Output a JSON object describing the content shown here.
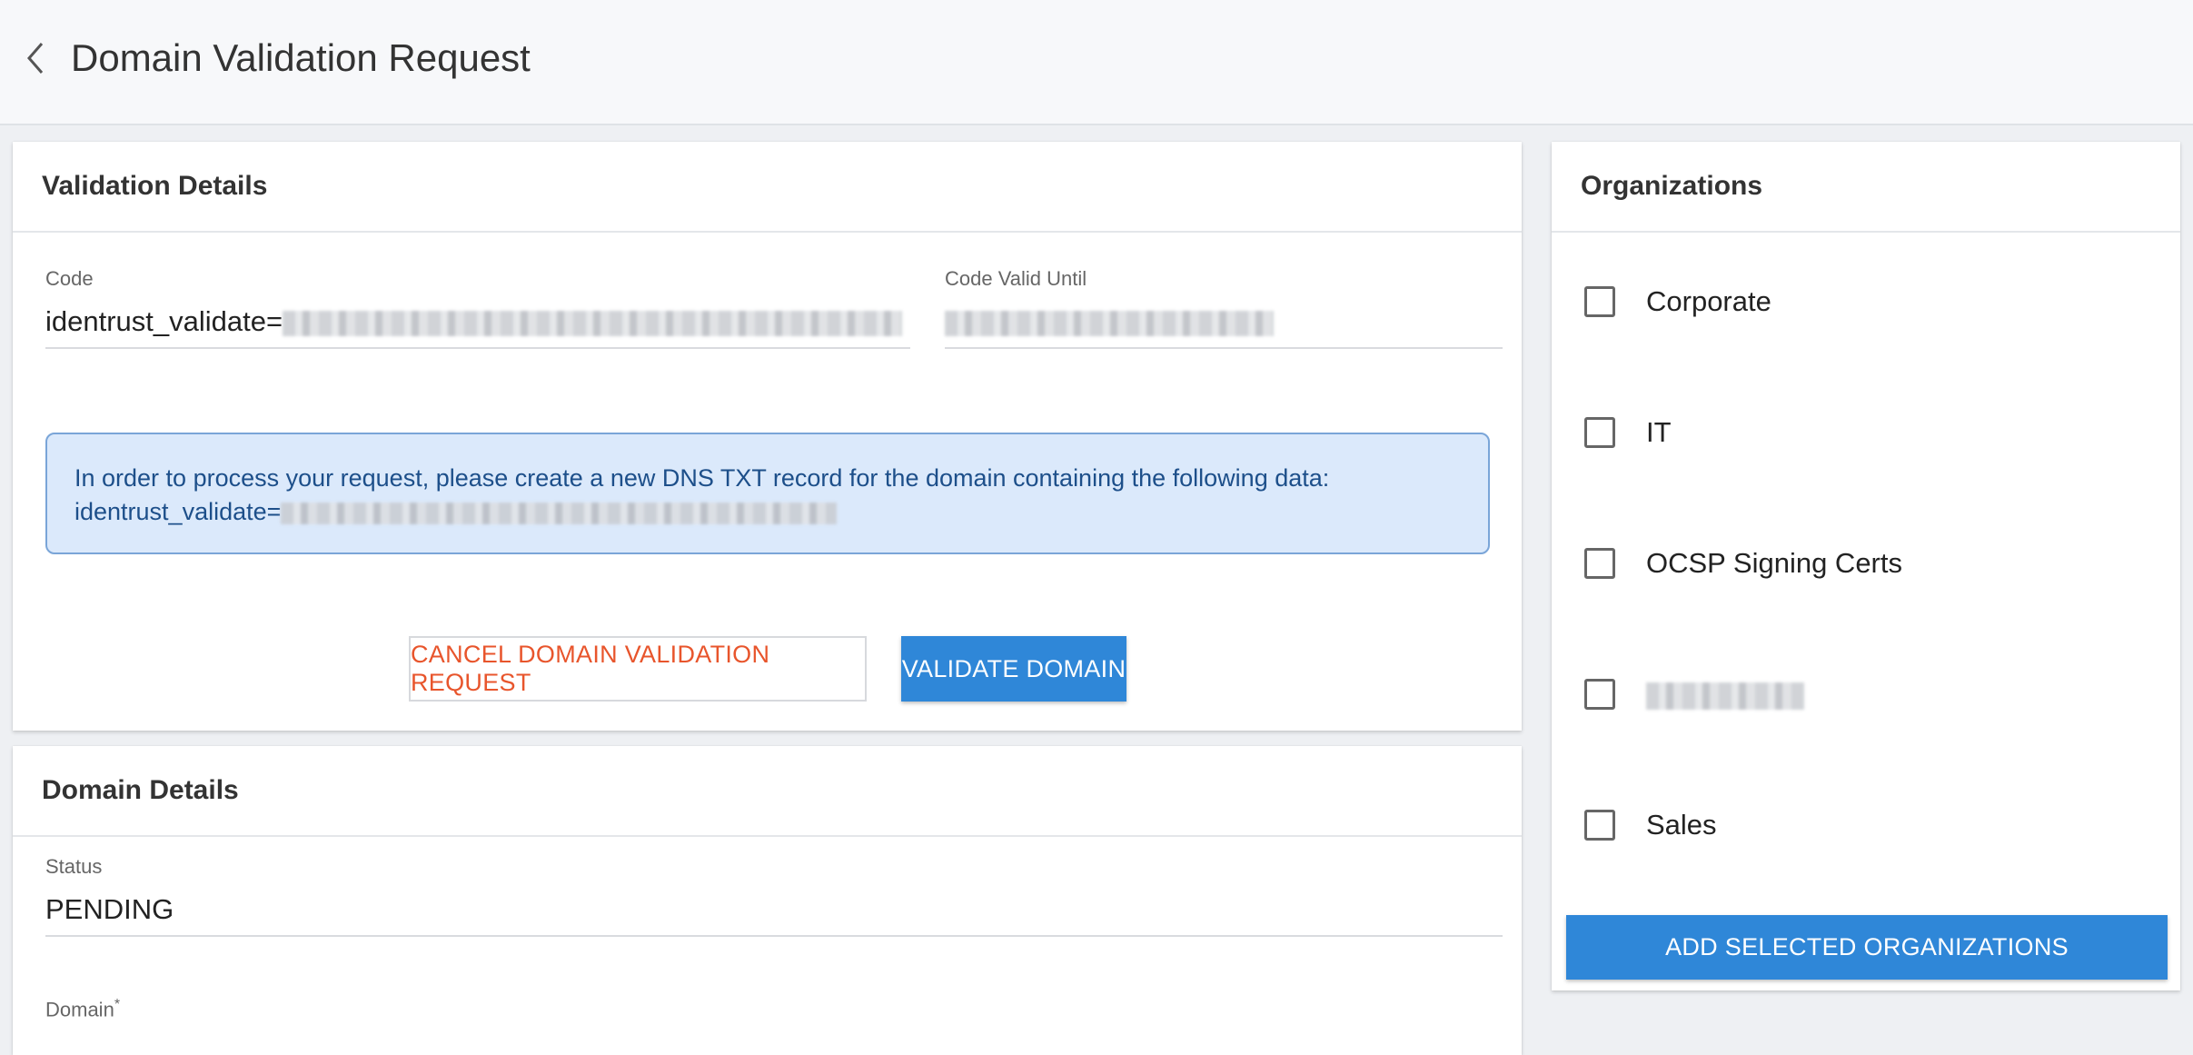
{
  "header": {
    "title": "Domain Validation Request",
    "back_icon": "chevron-left-icon"
  },
  "validation": {
    "title": "Validation Details",
    "code_label": "Code",
    "code_prefix": "identrust_validate=",
    "code_valid_until_label": "Code Valid Until",
    "info_line1": "In order to process your request, please create a new DNS TXT record for the domain containing the following data:",
    "info_line2_prefix": "identrust_validate=",
    "cancel_label": "CANCEL DOMAIN VALIDATION REQUEST",
    "validate_label": "VALIDATE DOMAIN"
  },
  "domain_details": {
    "title": "Domain Details",
    "status_label": "Status",
    "status_value": "PENDING",
    "domain_label": "Domain",
    "domain_required_mark": "*"
  },
  "organizations": {
    "title": "Organizations",
    "items": [
      {
        "label": "Corporate",
        "checked": false
      },
      {
        "label": "IT",
        "checked": false
      },
      {
        "label": "OCSP Signing Certs",
        "checked": false
      },
      {
        "label": "",
        "checked": false,
        "redacted": true
      },
      {
        "label": "Sales",
        "checked": false
      }
    ],
    "add_button_label": "ADD SELECTED ORGANIZATIONS"
  },
  "colors": {
    "primary": "#2f87d8",
    "danger": "#e8552c",
    "info_bg": "#dbe9fb",
    "info_text": "#1d4f8a"
  }
}
